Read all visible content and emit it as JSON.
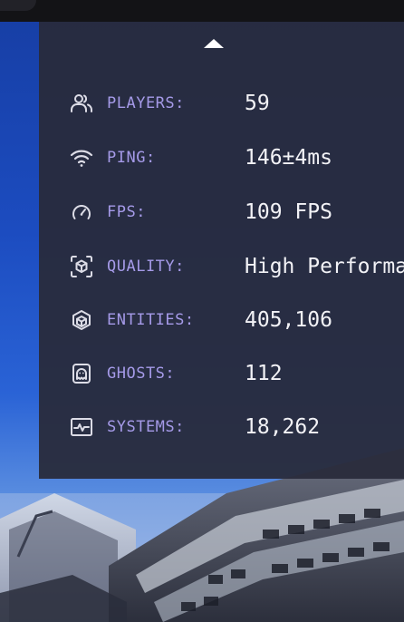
{
  "toolbar": {
    "collapse_icon": "caret-up-icon"
  },
  "stats": [
    {
      "icon": "users-icon",
      "label": "PLAYERS:",
      "value": "59"
    },
    {
      "icon": "wifi-icon",
      "label": "PING:",
      "value": "146±4ms"
    },
    {
      "icon": "speedometer-icon",
      "label": "FPS:",
      "value": "109 FPS"
    },
    {
      "icon": "scan-cube-icon",
      "label": "QUALITY:",
      "value": "High Performance"
    },
    {
      "icon": "cube-icon",
      "label": "ENTITIES:",
      "value": "405,106"
    },
    {
      "icon": "ghost-icon",
      "label": "GHOSTS:",
      "value": "112"
    },
    {
      "icon": "activity-monitor-icon",
      "label": "SYSTEMS:",
      "value": "18,262"
    }
  ],
  "colors": {
    "panel_bg": "#282a3a",
    "label": "#a59ae8",
    "value": "#f2f2f6",
    "icon": "#dcdce6"
  }
}
